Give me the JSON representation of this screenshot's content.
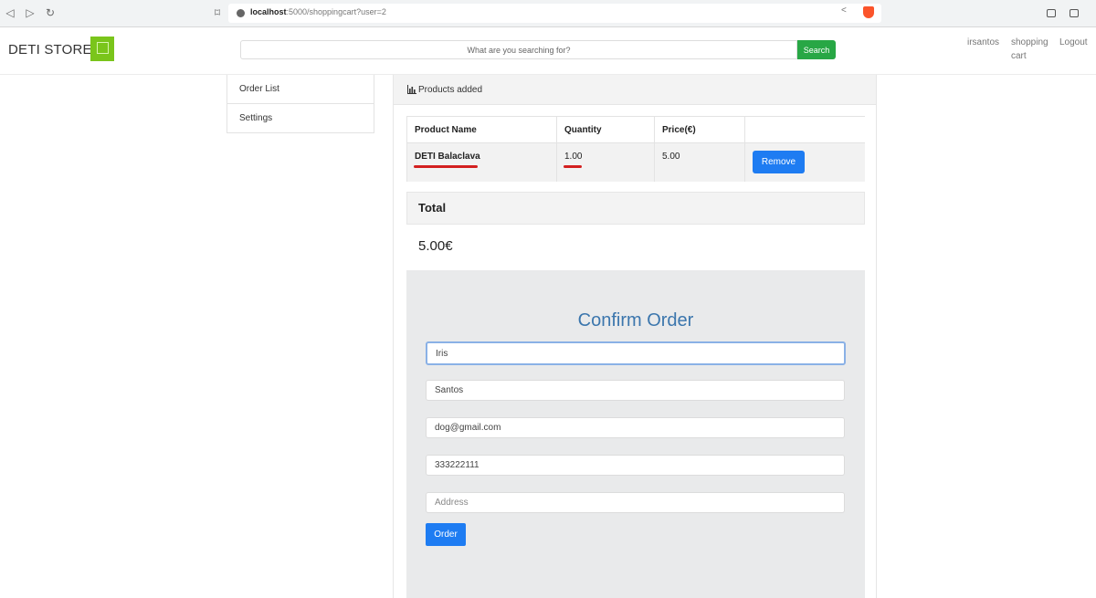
{
  "browser": {
    "url_host": "localhost",
    "url_rest": ":5000/shoppingcart?user=2"
  },
  "header": {
    "brand": "DETI STORE",
    "search_placeholder": "What are you searching for?",
    "search_button": "Search",
    "nav": {
      "username": "irsantos",
      "cart_line1": "shopping",
      "cart_line2": "cart",
      "logout": "Logout"
    }
  },
  "sidebar": {
    "items": [
      {
        "label": "Order List"
      },
      {
        "label": "Settings"
      }
    ]
  },
  "cart": {
    "panel_title": "Products added",
    "columns": [
      "Product Name",
      "Quantity",
      "Price(€)"
    ],
    "rows": [
      {
        "name": "DETI Balaclava",
        "quantity": "1.00",
        "price": "5.00",
        "action": "Remove"
      }
    ]
  },
  "total": {
    "label": "Total",
    "value": "5.00€"
  },
  "confirm": {
    "title": "Confirm Order",
    "first_name": "Iris",
    "last_name": "Santos",
    "email": "dog@gmail.com",
    "phone": "333222111",
    "address_placeholder": "Address",
    "order_button": "Order"
  },
  "colors": {
    "accent_blue": "#1e7cf2",
    "search_green": "#28a745",
    "logo_green": "#7ac51b",
    "title_blue": "#3b76ad",
    "annotation_red": "#d32020"
  }
}
